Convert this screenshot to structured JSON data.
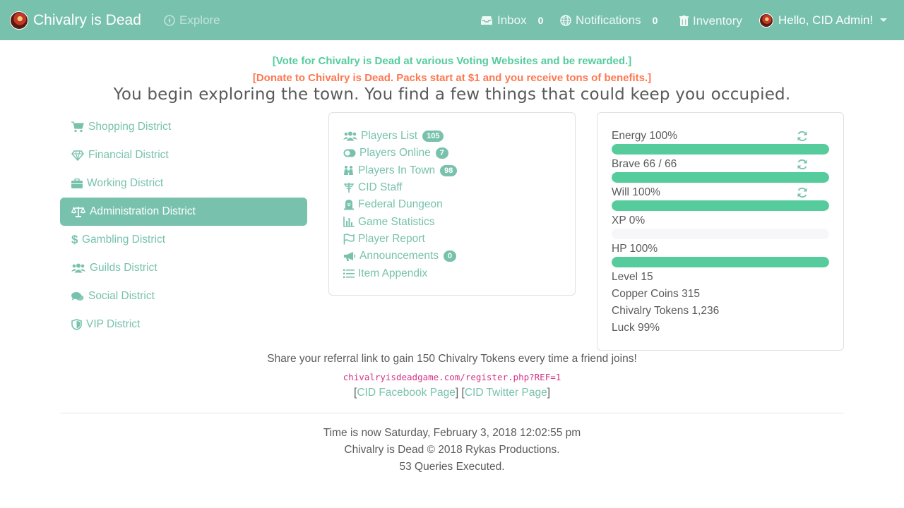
{
  "navbar": {
    "brand": "Chivalry is Dead",
    "explore": "Explore",
    "inbox_label": "Inbox",
    "inbox_count": "0",
    "notifications_label": "Notifications",
    "notifications_count": "0",
    "inventory_label": "Inventory",
    "user_greeting": "Hello, CID Admin!"
  },
  "banners": {
    "vote": "[Vote for Chivalry is Dead at various Voting Websites and be rewarded.]",
    "donate": "[Donate to Chivalry is Dead. Packs start at $1 and you receive tons of benefits.]"
  },
  "headline": "You begin exploring the town. You find a few things that could keep you occupied.",
  "districts": [
    {
      "label": "Shopping District",
      "icon": "cart-icon",
      "active": false
    },
    {
      "label": "Financial District",
      "icon": "gem-icon",
      "active": false
    },
    {
      "label": "Working District",
      "icon": "briefcase-icon",
      "active": false
    },
    {
      "label": "Administration District",
      "icon": "balance-scale-icon",
      "active": true
    },
    {
      "label": "Gambling District",
      "icon": "dollar-icon",
      "active": false
    },
    {
      "label": "Guilds District",
      "icon": "users-icon",
      "active": false
    },
    {
      "label": "Social District",
      "icon": "comments-icon",
      "active": false
    },
    {
      "label": "VIP District",
      "icon": "shield-icon",
      "active": false
    }
  ],
  "links": [
    {
      "label": "Players List",
      "icon": "users-icon",
      "badge": "105"
    },
    {
      "label": "Players Online",
      "icon": "toggle-on-icon",
      "badge": "7"
    },
    {
      "label": "Players In Town",
      "icon": "people-icon",
      "badge": "98"
    },
    {
      "label": "CID Staff",
      "icon": "staff-icon",
      "badge": null
    },
    {
      "label": "Federal Dungeon",
      "icon": "tombstone-icon",
      "badge": null
    },
    {
      "label": "Game Statistics",
      "icon": "bar-chart-icon",
      "badge": null
    },
    {
      "label": "Player Report",
      "icon": "flag-icon",
      "badge": null
    },
    {
      "label": "Announcements",
      "icon": "bullhorn-icon",
      "badge": "0"
    },
    {
      "label": "Item Appendix",
      "icon": "list-icon",
      "badge": null
    }
  ],
  "stats": {
    "energy_label": "Energy 100%",
    "energy_pct": 100,
    "brave_label": "Brave 66 / 66",
    "brave_pct": 100,
    "will_label": "Will 100%",
    "will_pct": 100,
    "xp_label": "XP 0%",
    "xp_pct": 0,
    "hp_label": "HP 100%",
    "hp_pct": 100,
    "level": "Level 15",
    "copper": "Copper Coins 315",
    "tokens": "Chivalry Tokens 1,236",
    "luck": "Luck 99%"
  },
  "referral": {
    "text": "Share your referral link to gain 150 Chivalry Tokens every time a friend joins!",
    "link": "chivalryisdeadgame.com/register.php?REF=1"
  },
  "social": {
    "facebook": "CID Facebook Page",
    "twitter": "CID Twitter Page"
  },
  "footer": {
    "time": "Time is now Saturday, February 3, 2018 12:02:55 pm",
    "copyright": "Chivalry is Dead © 2018 Rykas Productions.",
    "queries": "53 Queries Executed."
  },
  "colors": {
    "primary": "#78c2ad",
    "success": "#56cc9d",
    "warning": "#ff7851",
    "code": "#d63384"
  }
}
